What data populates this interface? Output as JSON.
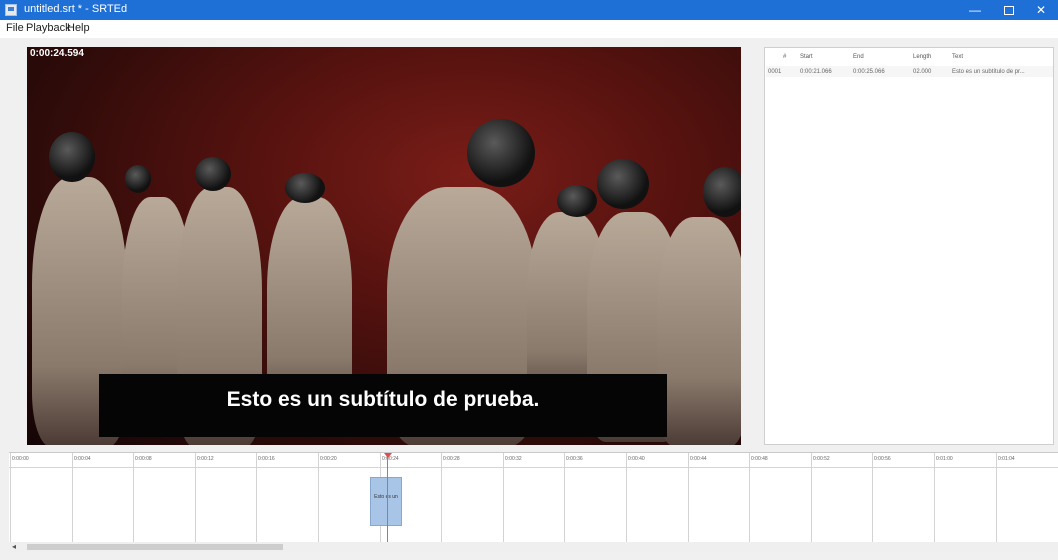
{
  "window": {
    "title": "untitled.srt * - SRTEd",
    "minimize": "—",
    "close": "✕"
  },
  "menu": [
    "File",
    "Playback",
    "Help"
  ],
  "video": {
    "timecode": "0:00:24.594",
    "subtitle": "Esto es un subtítulo de prueba."
  },
  "subtitle_table": {
    "headers": [
      "#",
      "Start",
      "End",
      "Length",
      "Text"
    ],
    "rows": [
      {
        "num": "0001",
        "start": "0:00:21.066",
        "end": "0:00:25.066",
        "length": "02.000",
        "text": "Esto es un subtítulo de pr..."
      }
    ]
  },
  "timeline": {
    "ticks": [
      "0:00:00",
      "0:00:04",
      "0:00:08",
      "0:00:12",
      "0:00:16",
      "0:00:20",
      "0:00:24",
      "0:00:28",
      "0:00:32",
      "0:00:36",
      "0:00:40",
      "0:00:44",
      "0:00:48",
      "0:00:52",
      "0:00:56",
      "0:01:00",
      "0:01:04"
    ],
    "block_label": "Esto es un"
  },
  "scrollbar": {
    "left_arrow": "◂"
  }
}
